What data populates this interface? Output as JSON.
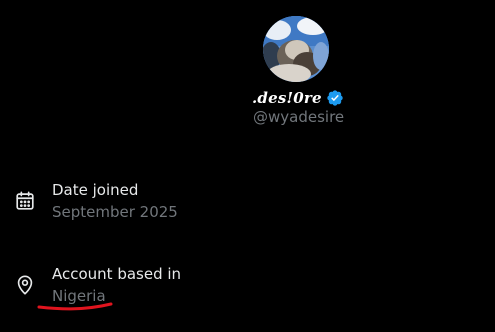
{
  "profile": {
    "display_name": ".des!0re",
    "handle": "@wyadesire",
    "verified_icon": "verified-badge-icon",
    "avatar_icon": "avatar-photo"
  },
  "about": {
    "date_joined": {
      "icon": "calendar-icon",
      "label": "Date joined",
      "value": "September 2025"
    },
    "account_based_in": {
      "icon": "location-pin-icon",
      "label": "Account based in",
      "value": "Nigeria"
    }
  },
  "colors": {
    "background": "#000000",
    "primary_text": "#e7e9ea",
    "secondary_text": "#71767b",
    "verified_blue": "#1d9bf0",
    "annotation_red": "#e0141e"
  }
}
